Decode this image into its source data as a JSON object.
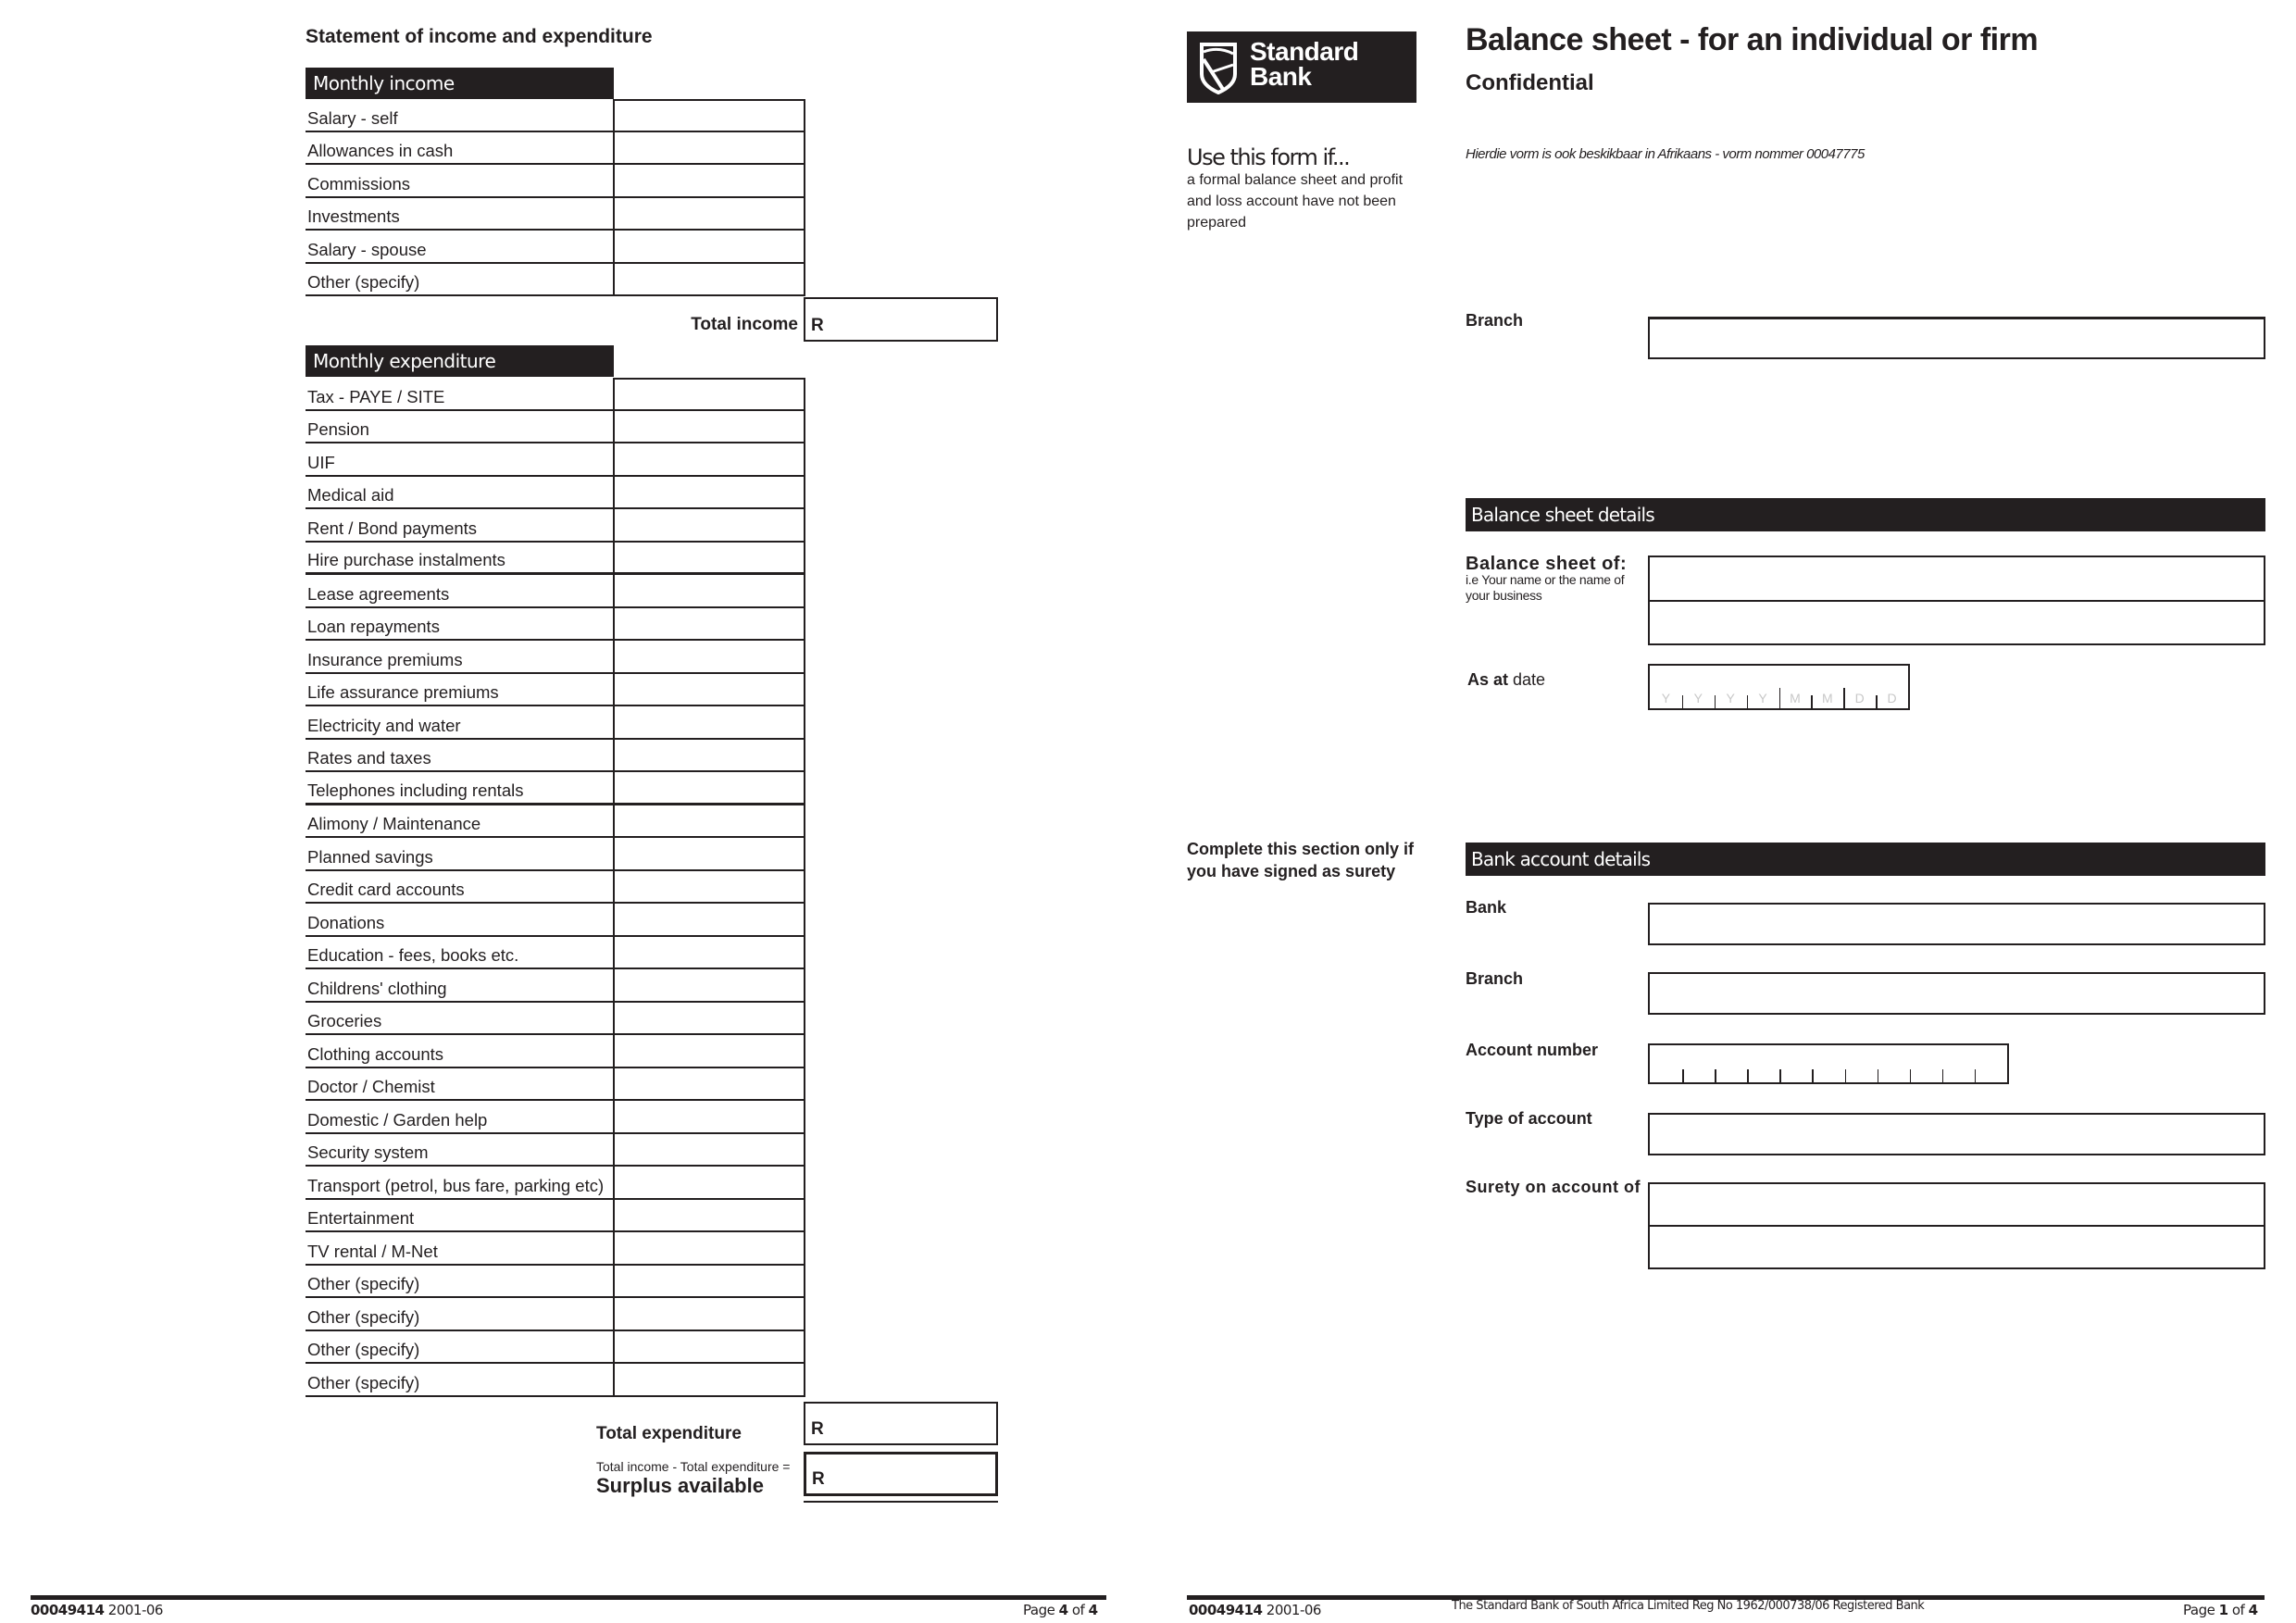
{
  "left_page": {
    "title": "Statement of income and expenditure",
    "income": {
      "heading": "Monthly income",
      "items": [
        "Salary - self",
        "Allowances in cash",
        "Commissions",
        "Investments",
        "Salary - spouse",
        "Other (specify)"
      ],
      "total_label": "Total income",
      "currency": "R"
    },
    "expenditure": {
      "heading": "Monthly expenditure",
      "items": [
        "Tax - PAYE / SITE",
        "Pension",
        "UIF",
        "Medical aid",
        "Rent / Bond payments",
        "Hire purchase instalments",
        "Lease agreements",
        "Loan repayments",
        "Insurance premiums",
        "Life assurance premiums",
        "Electricity and water",
        "Rates and taxes",
        "Telephones including rentals",
        "Alimony / Maintenance",
        "Planned savings",
        "Credit card accounts",
        "Donations",
        "Education - fees, books etc.",
        "Childrens' clothing",
        "Groceries",
        "Clothing accounts",
        "Doctor / Chemist",
        "Domestic / Garden help",
        "Security system",
        "Transport (petrol, bus fare, parking etc)",
        "Entertainment",
        "TV rental / M-Net",
        "Other (specify)",
        "Other (specify)",
        "Other (specify)",
        "Other (specify)"
      ],
      "total_label": "Total expenditure",
      "currency": "R"
    },
    "surplus": {
      "formula": "Total income - Total expenditure =",
      "label": "Surplus available",
      "currency": "R"
    },
    "footer": {
      "form_number": "00049414",
      "date": "2001-06",
      "page_prefix": "Page",
      "page_num": "4",
      "page_of": "of",
      "page_total": "4"
    }
  },
  "right_page": {
    "logo": {
      "line1": "Standard",
      "line2": "Bank",
      "icon": "shield-flag-icon"
    },
    "title": "Balance sheet - for an individual or firm",
    "subtitle": "Confidential",
    "use_form": {
      "heading": "Use this form if...",
      "description": "a formal balance sheet and profit and loss account have not been prepared"
    },
    "afrikaans_note": "Hierdie vorm is ook beskikbaar in Afrikaans - vorm nommer 00047775",
    "branch_label": "Branch",
    "balance_sheet_details": {
      "heading": "Balance sheet details",
      "of_label": "Balance sheet of:",
      "of_hint": "i.e Your name or the name of your business",
      "as_at_bold": "As at",
      "as_at_rest": "date",
      "date_segments": [
        "Y",
        "Y",
        "Y",
        "Y",
        "M",
        "M",
        "D",
        "D"
      ]
    },
    "surety_note": "Complete this section only if you have signed as surety",
    "bank_account_details": {
      "heading": "Bank account details",
      "bank_label": "Bank",
      "branch_label": "Branch",
      "account_number_label": "Account number",
      "account_number_digits": 11,
      "type_label": "Type of account",
      "surety_label": "Surety on account of"
    },
    "footer": {
      "form_number": "00049414",
      "date": "2001-06",
      "registration": "The Standard Bank of South Africa Limited Reg No 1962/000738/06 Registered Bank",
      "page_prefix": "Page",
      "page_num": "1",
      "page_of": "of",
      "page_total": "4"
    }
  }
}
